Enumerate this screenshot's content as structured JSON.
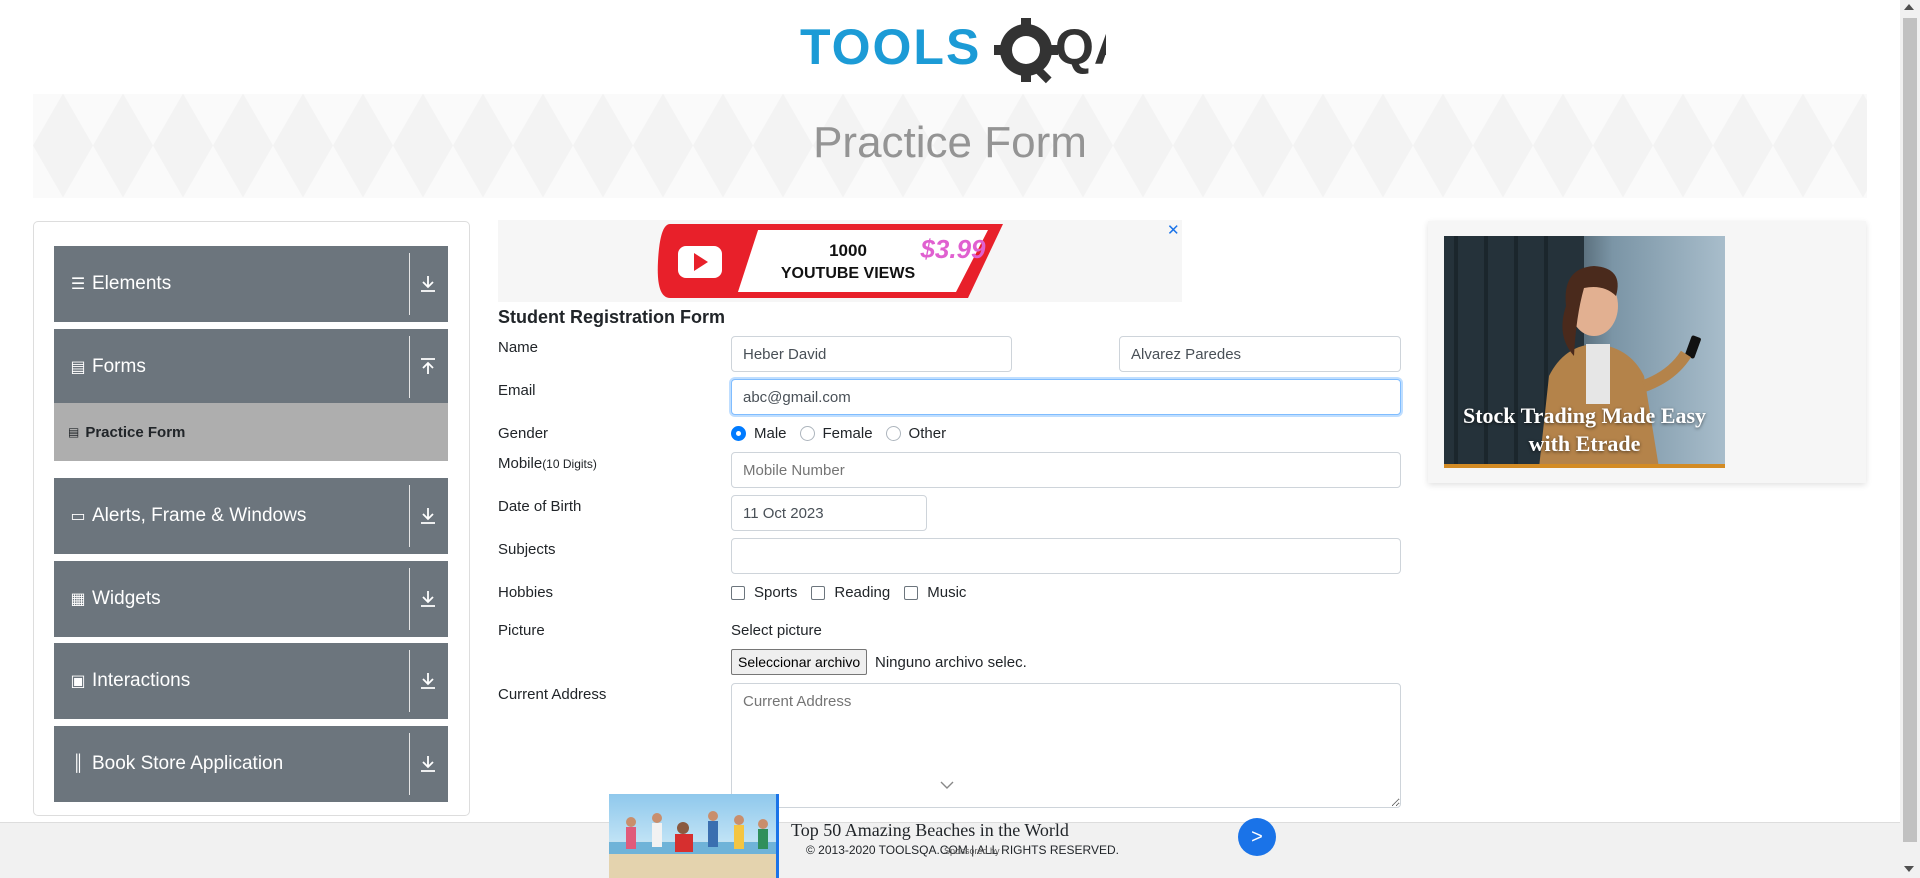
{
  "header": {
    "logo_text_left": "TOOLS",
    "logo_text_right": "QA",
    "page_title": "Practice Form"
  },
  "sidebar": {
    "groups": [
      {
        "label": "Elements",
        "icon": "hamburger-icon",
        "state": "collapsed"
      },
      {
        "label": "Forms",
        "icon": "document-icon",
        "state": "expanded"
      },
      {
        "label": "Alerts, Frame & Windows",
        "icon": "window-icon",
        "state": "collapsed"
      },
      {
        "label": "Widgets",
        "icon": "grid-icon",
        "state": "collapsed"
      },
      {
        "label": "Interactions",
        "icon": "box-icon",
        "state": "collapsed"
      },
      {
        "label": "Book Store Application",
        "icon": "books-icon",
        "state": "collapsed"
      }
    ],
    "active_item": "Practice Form"
  },
  "top_ad": {
    "line1": "1000",
    "line2": "YOUTUBE VIEWS",
    "price": "$3.99",
    "close": "✕"
  },
  "form": {
    "title": "Student Registration Form",
    "name_label": "Name",
    "first_name": "Heber David",
    "last_name": "Alvarez Paredes",
    "email_label": "Email",
    "email": "abc@gmail.com",
    "gender_label": "Gender",
    "gender_options": [
      "Male",
      "Female",
      "Other"
    ],
    "gender_selected": "Male",
    "mobile_label": "Mobile",
    "mobile_hint": "(10 Digits)",
    "mobile_placeholder": "Mobile Number",
    "dob_label": "Date of Birth",
    "dob": "11 Oct 2023",
    "subjects_label": "Subjects",
    "hobbies_label": "Hobbies",
    "hobbies": [
      "Sports",
      "Reading",
      "Music"
    ],
    "picture_label": "Picture",
    "select_picture": "Select picture",
    "file_button": "Seleccionar archivo",
    "file_status": "Ninguno archivo selec.",
    "address_label": "Current Address",
    "address_placeholder": "Current Address"
  },
  "right_ad": {
    "caption": "Stock Trading Made Easy with Etrade"
  },
  "bottom_ad": {
    "title": "Top 50 Amazing Beaches in the World",
    "sponsor": "Sponsored by",
    "button": ">"
  },
  "footer": {
    "text": "© 2013-2020 TOOLSQA.COM | ALL RIGHTS RESERVED."
  },
  "colors": {
    "brand_blue": "#1c9bd6",
    "brand_dark": "#333333",
    "sidebar_group": "#6c757d",
    "sidebar_active": "#aeaeae",
    "focus_border": "#80bdff",
    "radio_checked": "#007bff"
  }
}
